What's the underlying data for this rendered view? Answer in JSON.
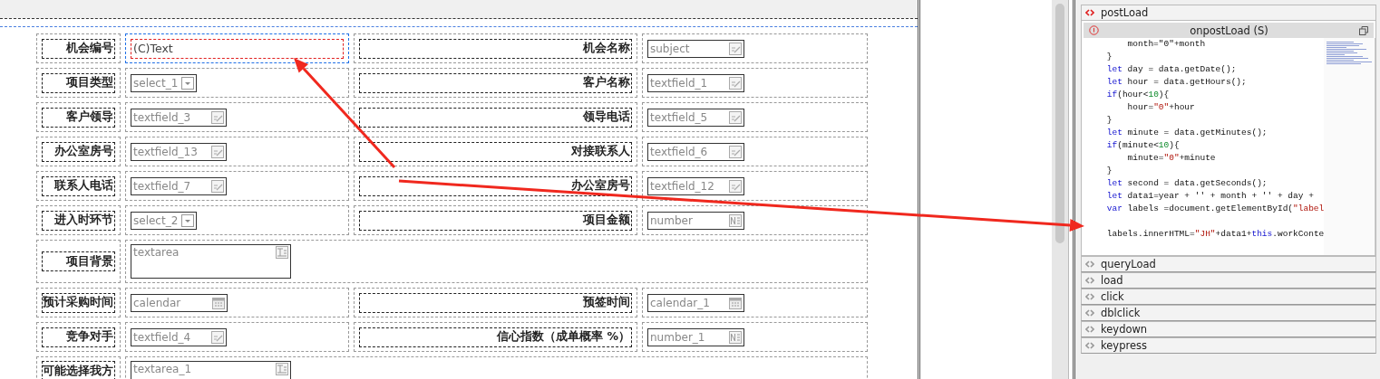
{
  "form": {
    "rows": [
      {
        "kind": "pair",
        "label": "机会编号",
        "field": {
          "kind": "label",
          "text": "(C)Text",
          "selected": true
        },
        "label_2": "机会名称",
        "field_2": {
          "kind": "text",
          "text": "subject",
          "selected": false
        }
      },
      {
        "kind": "pair",
        "label": "项目类型",
        "field": {
          "kind": "select",
          "text": "select_1",
          "selected": false
        },
        "label_2": "客户名称",
        "field_2": {
          "kind": "text",
          "text": "textfield_1",
          "selected": false
        }
      },
      {
        "kind": "pair",
        "label": "客户领导",
        "field": {
          "kind": "text",
          "text": "textfield_3",
          "selected": false
        },
        "label_2": "领导电话",
        "field_2": {
          "kind": "text",
          "text": "textfield_5",
          "selected": false
        }
      },
      {
        "kind": "pair",
        "label": "办公室房号",
        "field": {
          "kind": "text",
          "text": "textfield_13",
          "selected": false
        },
        "label_2": "对接联系人",
        "field_2": {
          "kind": "text",
          "text": "textfield_6",
          "selected": false
        }
      },
      {
        "kind": "pair",
        "label": "联系人电话",
        "field": {
          "kind": "text",
          "text": "textfield_7",
          "selected": false
        },
        "label_2": "办公室房号",
        "field_2": {
          "kind": "text",
          "text": "textfield_12",
          "selected": false
        }
      },
      {
        "kind": "pair",
        "label": "进入时环节",
        "field": {
          "kind": "select",
          "text": "select_2",
          "selected": false
        },
        "label_2": "项目金额",
        "field_2": {
          "kind": "number",
          "text": "number",
          "selected": false
        }
      },
      {
        "kind": "wide",
        "label": "项目背景",
        "field": {
          "kind": "textarea",
          "text": "textarea",
          "selected": false
        }
      },
      {
        "kind": "pair",
        "label": "预计采购时间",
        "field": {
          "kind": "calendar",
          "text": "calendar",
          "selected": false
        },
        "label_2": "预签时间",
        "field_2": {
          "kind": "calendar",
          "text": "calendar_1",
          "selected": false
        }
      },
      {
        "kind": "pair",
        "label": "竞争对手",
        "field": {
          "kind": "text",
          "text": "textfield_4",
          "selected": false
        },
        "label_2": "信心指数（成单概率 %）",
        "field_2": {
          "kind": "number",
          "text": "number_1",
          "selected": false
        }
      },
      {
        "kind": "tall",
        "label": "可能选择我方",
        "field": {
          "kind": "textarea",
          "text": "textarea_1",
          "selected": false
        }
      }
    ]
  },
  "events": {
    "items": [
      {
        "name": "postLoad",
        "expanded": true
      },
      {
        "name": "queryLoad",
        "expanded": false
      },
      {
        "name": "load",
        "expanded": false
      },
      {
        "name": "click",
        "expanded": false
      },
      {
        "name": "dblclick",
        "expanded": false
      },
      {
        "name": "keydown",
        "expanded": false
      },
      {
        "name": "keypress",
        "expanded": false
      }
    ],
    "editor": {
      "title": "onpostLoad (S)",
      "lines": [
        [
          {
            "kind": "plain",
            "text": "        month=\"0\"+month"
          }
        ],
        [
          {
            "kind": "plain",
            "text": "    }"
          }
        ],
        [
          {
            "kind": "keyword",
            "text": "    let"
          },
          {
            "kind": "plain",
            "text": " day = data.getDate();"
          }
        ],
        [
          {
            "kind": "keyword",
            "text": "    let"
          },
          {
            "kind": "plain",
            "text": " hour = data.getHours();"
          }
        ],
        [
          {
            "kind": "keyword",
            "text": "    if"
          },
          {
            "kind": "plain",
            "text": "(hour<"
          },
          {
            "kind": "number",
            "text": "10"
          },
          {
            "kind": "plain",
            "text": "){"
          }
        ],
        [
          {
            "kind": "plain",
            "text": "        hour="
          },
          {
            "kind": "string",
            "text": "\"0\""
          },
          {
            "kind": "plain",
            "text": "+hour"
          }
        ],
        [
          {
            "kind": "plain",
            "text": "    }"
          }
        ],
        [
          {
            "kind": "keyword",
            "text": "    let"
          },
          {
            "kind": "plain",
            "text": " minute = data.getMinutes();"
          }
        ],
        [
          {
            "kind": "keyword",
            "text": "    if"
          },
          {
            "kind": "plain",
            "text": "(minute<"
          },
          {
            "kind": "number",
            "text": "10"
          },
          {
            "kind": "plain",
            "text": "){"
          }
        ],
        [
          {
            "kind": "plain",
            "text": "        minute="
          },
          {
            "kind": "string",
            "text": "\"0\""
          },
          {
            "kind": "plain",
            "text": "+minute"
          }
        ],
        [
          {
            "kind": "plain",
            "text": "    }"
          }
        ],
        [
          {
            "kind": "keyword",
            "text": "    let"
          },
          {
            "kind": "plain",
            "text": " second = data.getSeconds();"
          }
        ],
        [
          {
            "kind": "keyword",
            "text": "    let"
          },
          {
            "kind": "plain",
            "text": " data1=year + '' + month + '' + day +"
          }
        ],
        [
          {
            "kind": "keyword",
            "text": "    var"
          },
          {
            "kind": "plain",
            "text": " labels =document.getElementById("
          },
          {
            "kind": "string",
            "text": "\"label"
          }
        ],
        [
          {
            "kind": "gap"
          },
          {
            "kind": "plain",
            "text": "    labels.innerHTML="
          },
          {
            "kind": "string",
            "text": "\"JH\""
          },
          {
            "kind": "plain",
            "text": "+data1+"
          },
          {
            "kind": "keyword",
            "text": "this"
          },
          {
            "kind": "plain",
            "text": ".workConte"
          }
        ]
      ]
    }
  }
}
